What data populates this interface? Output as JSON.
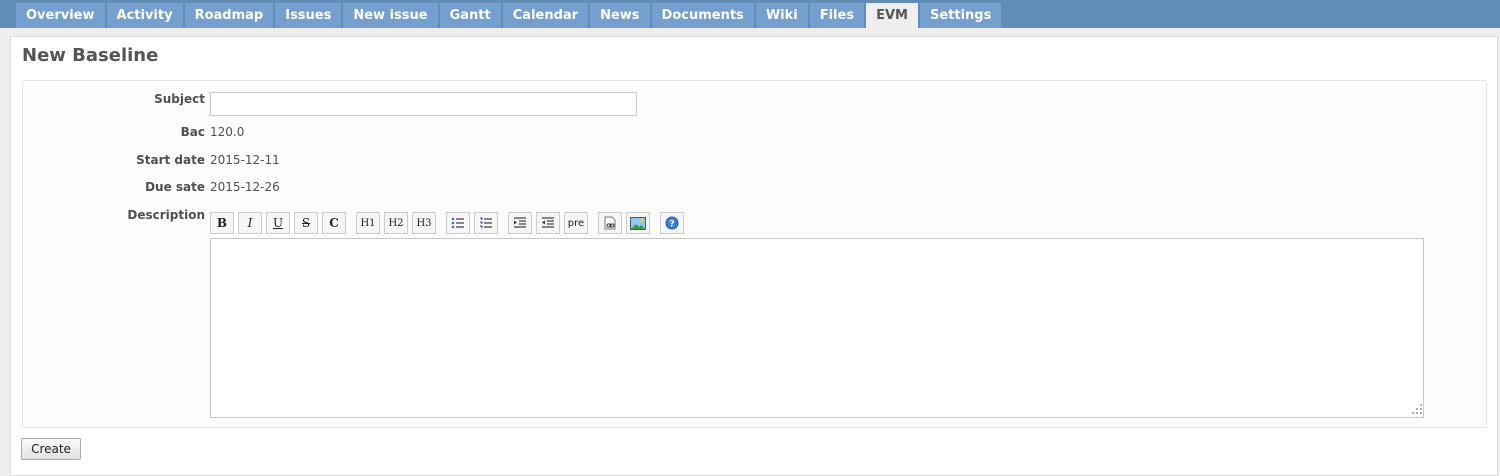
{
  "tabs": [
    {
      "label": "Overview"
    },
    {
      "label": "Activity"
    },
    {
      "label": "Roadmap"
    },
    {
      "label": "Issues"
    },
    {
      "label": "New issue"
    },
    {
      "label": "Gantt"
    },
    {
      "label": "Calendar"
    },
    {
      "label": "News"
    },
    {
      "label": "Documents"
    },
    {
      "label": "Wiki"
    },
    {
      "label": "Files"
    },
    {
      "label": "EVM",
      "selected": true
    },
    {
      "label": "Settings"
    }
  ],
  "page": {
    "title": "New Baseline"
  },
  "form": {
    "subject_label": "Subject",
    "subject_value": "",
    "bac_label": "Bac",
    "bac_value": "120.0",
    "start_label": "Start date",
    "start_value": "2015-12-11",
    "due_label": "Due sate",
    "due_value": "2015-12-26",
    "description_label": "Description",
    "description_value": "",
    "create_label": "Create"
  },
  "toolbar": {
    "bold": "B",
    "italic": "I",
    "underline": "U",
    "strike": "S",
    "code": "C",
    "h1": "H1",
    "h2": "H2",
    "h3": "H3",
    "pre": "pre",
    "icons": [
      "bold-icon",
      "italic-icon",
      "underline-icon",
      "strikethrough-icon",
      "inline-code-icon",
      "heading1-icon",
      "heading2-icon",
      "heading3-icon",
      "unordered-list-icon",
      "ordered-list-icon",
      "indent-icon",
      "outdent-icon",
      "preformatted-icon",
      "wiki-link-icon",
      "image-icon",
      "help-icon"
    ]
  },
  "colors": {
    "tabbar": "#628db6",
    "tab": "#759fcf",
    "tab_selected": "#eeeeee",
    "background": "#eeeeee"
  }
}
